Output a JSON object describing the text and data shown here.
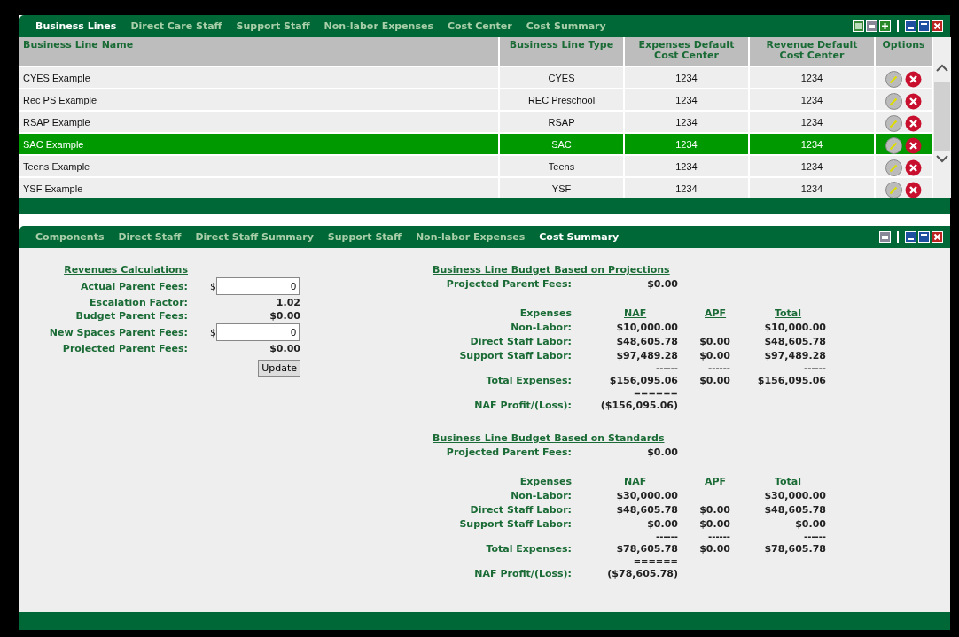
{
  "top_panel": {
    "tabs": [
      {
        "label": "Business Lines",
        "selected": true
      },
      {
        "label": "Direct Care Staff",
        "selected": false
      },
      {
        "label": "Support Staff",
        "selected": false
      },
      {
        "label": "Non-labor Expenses",
        "selected": false
      },
      {
        "label": "Cost Center",
        "selected": false
      },
      {
        "label": "Cost Summary",
        "selected": false
      }
    ],
    "table": {
      "columns": [
        "Business Line Name",
        "Business Line Type",
        "Expenses Default Cost Center",
        "Revenue Default Cost Center",
        "Options"
      ],
      "rows": [
        {
          "name": "CYES Example",
          "type": "CYES",
          "expenses_cost_center": "1234",
          "revenue_cost_center": "1234",
          "selected": false
        },
        {
          "name": "Rec PS Example",
          "type": "REC Preschool",
          "expenses_cost_center": "1234",
          "revenue_cost_center": "1234",
          "selected": false
        },
        {
          "name": "RSAP Example",
          "type": "RSAP",
          "expenses_cost_center": "1234",
          "revenue_cost_center": "1234",
          "selected": false
        },
        {
          "name": "SAC Example",
          "type": "SAC",
          "expenses_cost_center": "1234",
          "revenue_cost_center": "1234",
          "selected": true
        },
        {
          "name": "Teens Example",
          "type": "Teens",
          "expenses_cost_center": "1234",
          "revenue_cost_center": "1234",
          "selected": false
        },
        {
          "name": "YSF Example",
          "type": "YSF",
          "expenses_cost_center": "1234",
          "revenue_cost_center": "1234",
          "selected": false
        }
      ]
    }
  },
  "bottom_panel": {
    "tabs": [
      {
        "label": "Components",
        "selected": false
      },
      {
        "label": "Direct Staff",
        "selected": false
      },
      {
        "label": "Direct Staff Summary",
        "selected": false
      },
      {
        "label": "Support Staff",
        "selected": false
      },
      {
        "label": "Non-labor Expenses",
        "selected": false
      },
      {
        "label": "Cost Summary",
        "selected": true
      }
    ],
    "revenues": {
      "title": "Revenues Calculations",
      "fields": [
        {
          "kind": "input",
          "label": "Actual Parent Fees:",
          "prefix": "$",
          "value": "0"
        },
        {
          "kind": "value",
          "label": "Escalation Factor:",
          "value": "1.02"
        },
        {
          "kind": "value",
          "label": "Budget Parent Fees:",
          "value": "$0.00"
        },
        {
          "kind": "input",
          "label": "New Spaces Parent Fees:",
          "prefix": "$",
          "value": "0"
        },
        {
          "kind": "value",
          "label": "Projected Parent Fees:",
          "value": "$0.00"
        }
      ],
      "button": "Update"
    },
    "budgets": [
      {
        "title": "Business Line Budget Based on Projections",
        "projected_label": "Projected Parent Fees:",
        "projected_value": "$0.00",
        "headers": [
          "Expenses",
          "NAF",
          "APF",
          "Total"
        ],
        "rows": [
          {
            "label": "Non-Labor:",
            "naf": "$10,000.00",
            "total": "$10,000.00"
          },
          {
            "label": "Direct Staff Labor:",
            "naf": "$48,605.78",
            "apf": "$0.00",
            "total": "$48,605.78"
          },
          {
            "label": "Support Staff Labor:",
            "naf": "$97,489.28",
            "apf": "$0.00",
            "total": "$97,489.28"
          }
        ],
        "rule": [
          "------",
          "------",
          "------"
        ],
        "total_row": {
          "label": "Total Expenses:",
          "naf": "$156,095.06",
          "apf": "$0.00",
          "total": "$156,095.06"
        },
        "double_rule": "======",
        "profit_label": "NAF Profit/(Loss):",
        "profit_value": "($156,095.06)"
      },
      {
        "title": "Business Line Budget Based on Standards",
        "projected_label": "Projected Parent Fees:",
        "projected_value": "$0.00",
        "headers": [
          "Expenses",
          "NAF",
          "APF",
          "Total"
        ],
        "rows": [
          {
            "label": "Non-Labor:",
            "naf": "$30,000.00",
            "total": "$30,000.00"
          },
          {
            "label": "Direct Staff Labor:",
            "naf": "$48,605.78",
            "apf": "$0.00",
            "total": "$48,605.78"
          },
          {
            "label": "Support Staff Labor:",
            "naf": "$0.00",
            "apf": "$0.00",
            "total": "$0.00"
          }
        ],
        "rule": [
          "------",
          "------",
          "------"
        ],
        "total_row": {
          "label": "Total Expenses:",
          "naf": "$78,605.78",
          "apf": "$0.00",
          "total": "$78,605.78"
        },
        "double_rule": "======",
        "profit_label": "NAF Profit/(Loss):",
        "profit_value": "($78,605.78)"
      }
    ]
  }
}
